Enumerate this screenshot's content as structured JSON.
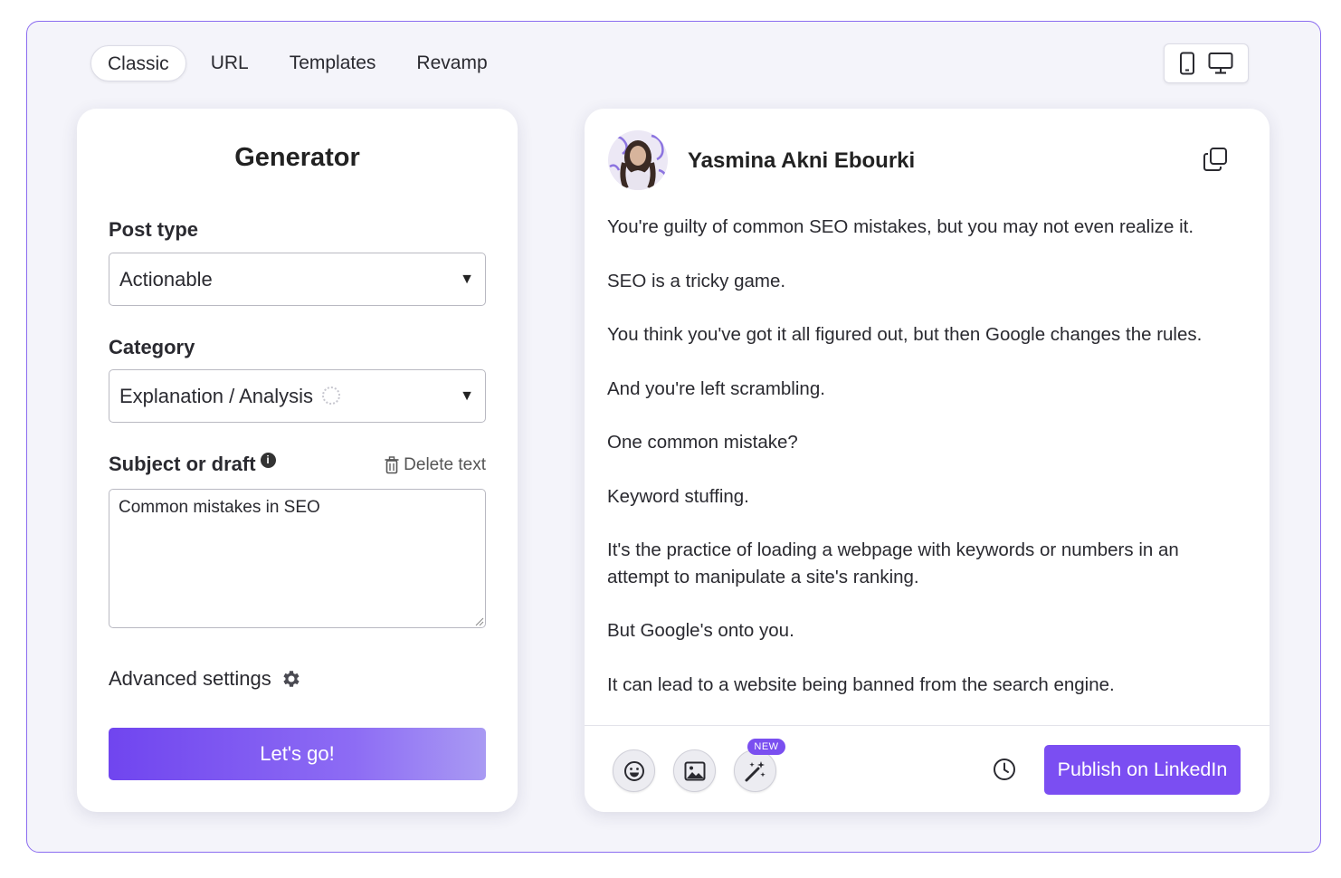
{
  "tabs": [
    {
      "label": "Classic",
      "active": true
    },
    {
      "label": "URL",
      "active": false
    },
    {
      "label": "Templates",
      "active": false
    },
    {
      "label": "Revamp",
      "active": false
    }
  ],
  "device_toggle": {
    "icons": [
      "mobile-icon",
      "desktop-icon"
    ]
  },
  "generator": {
    "title": "Generator",
    "post_type": {
      "label": "Post type",
      "value": "Actionable"
    },
    "category": {
      "label": "Category",
      "value": "Explanation / Analysis"
    },
    "subject": {
      "label": "Subject or draft",
      "delete_label": "Delete text",
      "value": "Common mistakes in SEO"
    },
    "advanced_label": "Advanced settings",
    "go_label": "Let's go!"
  },
  "post": {
    "author": "Yasmina Akni Ebourki",
    "paragraphs": [
      "You're guilty of common SEO mistakes, but you may not even realize it.",
      "SEO is a tricky game.",
      "You think you've got it all figured out, but then Google changes the rules.",
      "And you're left scrambling.",
      "One common mistake?",
      "Keyword stuffing.",
      "It's the practice of loading a webpage with keywords or numbers in an attempt to manipulate a site's ranking.",
      "But Google's onto you.",
      "It can lead to a website being banned from the search engine."
    ],
    "new_badge": "NEW",
    "publish_label": "Publish on LinkedIn"
  },
  "colors": {
    "accent": "#7b4ef2",
    "frame_border": "#8b6cf0",
    "background": "#f4f4fa"
  }
}
